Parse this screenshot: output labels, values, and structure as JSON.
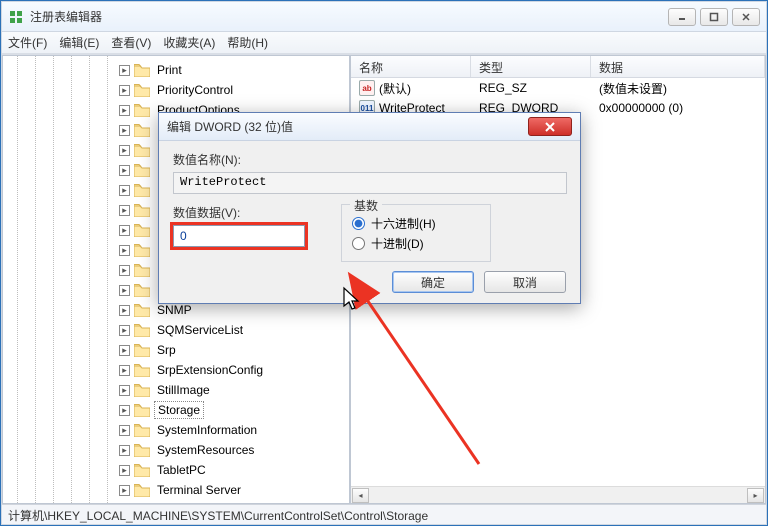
{
  "window": {
    "title": "注册表编辑器"
  },
  "menu": {
    "file": "文件(F)",
    "edit": "编辑(E)",
    "view": "查看(V)",
    "favorites": "收藏夹(A)",
    "help": "帮助(H)"
  },
  "tree": {
    "items": [
      {
        "depth": 6,
        "label": "Print"
      },
      {
        "depth": 6,
        "label": "PriorityControl"
      },
      {
        "depth": 6,
        "label": "ProductOptions"
      },
      {
        "depth": 6,
        "label": ""
      },
      {
        "depth": 6,
        "label": ""
      },
      {
        "depth": 6,
        "label": ""
      },
      {
        "depth": 6,
        "label": ""
      },
      {
        "depth": 6,
        "label": ""
      },
      {
        "depth": 6,
        "label": ""
      },
      {
        "depth": 6,
        "label": ""
      },
      {
        "depth": 6,
        "label": ""
      },
      {
        "depth": 6,
        "label": ""
      },
      {
        "depth": 6,
        "label": "SNMP"
      },
      {
        "depth": 6,
        "label": "SQMServiceList"
      },
      {
        "depth": 6,
        "label": "Srp"
      },
      {
        "depth": 6,
        "label": "SrpExtensionConfig"
      },
      {
        "depth": 6,
        "label": "StillImage"
      },
      {
        "depth": 6,
        "label": "Storage",
        "selected": true
      },
      {
        "depth": 6,
        "label": "SystemInformation"
      },
      {
        "depth": 6,
        "label": "SystemResources"
      },
      {
        "depth": 6,
        "label": "TabletPC"
      },
      {
        "depth": 6,
        "label": "Terminal Server"
      }
    ]
  },
  "list": {
    "columns": {
      "name": "名称",
      "type": "类型",
      "data": "数据"
    },
    "rows": [
      {
        "icon": "ab",
        "name": "(默认)",
        "type": "REG_SZ",
        "data": "(数值未设置)"
      },
      {
        "icon": "bin",
        "name": "WriteProtect",
        "type": "REG_DWORD",
        "data": "0x00000000 (0)"
      }
    ]
  },
  "dialog": {
    "title": "编辑 DWORD (32 位)值",
    "value_name_label": "数值名称(N):",
    "value_name": "WriteProtect",
    "value_data_label": "数值数据(V):",
    "value_data": "0",
    "radix_label": "基数",
    "radix_hex": "十六进制(H)",
    "radix_dec": "十进制(D)",
    "ok": "确定",
    "cancel": "取消"
  },
  "statusbar": {
    "path": "计算机\\HKEY_LOCAL_MACHINE\\SYSTEM\\CurrentControlSet\\Control\\Storage"
  }
}
